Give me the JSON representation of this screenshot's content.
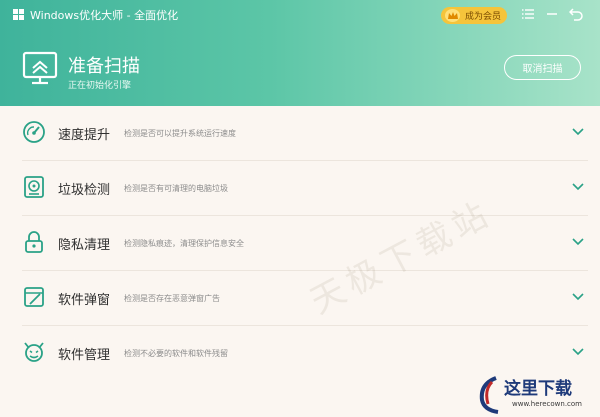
{
  "titlebar": {
    "title": "Windows优化大师 - 全面优化",
    "member_label": "成为会员",
    "icons": [
      "windows-logo-icon",
      "crown-icon",
      "menu-icon",
      "minimize-icon",
      "back-icon"
    ]
  },
  "header": {
    "title": "准备扫描",
    "subtitle": "正在初始化引擎",
    "cancel_label": "取消扫描"
  },
  "items": [
    {
      "name": "速度提升",
      "desc": "检测是否可以提升系统运行速度",
      "icon": "speedometer-icon"
    },
    {
      "name": "垃圾检测",
      "desc": "检测是否有可清理的电脑垃圾",
      "icon": "disk-icon"
    },
    {
      "name": "隐私清理",
      "desc": "检测隐私痕迹，清理保护信息安全",
      "icon": "lock-icon"
    },
    {
      "name": "软件弹窗",
      "desc": "检测是否存在恶意弹窗广告",
      "icon": "popup-window-icon"
    },
    {
      "name": "软件管理",
      "desc": "检测不必要的软件和软件残留",
      "icon": "devil-icon"
    }
  ],
  "watermark": {
    "center": "天极下载站",
    "corner": "这里下载",
    "corner_url": "www.herecown.com"
  },
  "colors": {
    "accent": "#3fb39b",
    "accent_light": "#a8e3c9",
    "icon": "#2aa287",
    "background": "#fbf6f1"
  }
}
